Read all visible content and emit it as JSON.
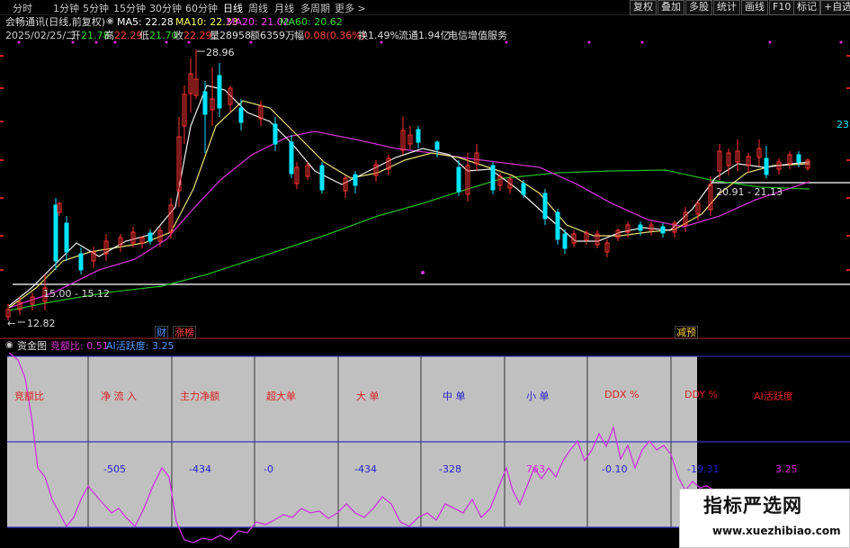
{
  "toolbar": {
    "timeframes": [
      "分时",
      "1分钟",
      "5分钟",
      "15分钟",
      "30分钟",
      "60分钟",
      "日线",
      "周线",
      "月线",
      "多周期",
      "更多 >"
    ],
    "active_timeframe": "日线",
    "right_buttons": [
      "复权",
      "叠加",
      "多股",
      "统计",
      "画线",
      "F10",
      "标记",
      "+自选"
    ]
  },
  "stock": {
    "name": "会畅通讯(日线,前复权)",
    "ma": [
      {
        "label": "MA5: 22.28",
        "color": "#ffffff"
      },
      {
        "label": "MA10: 22.33",
        "color": "#ffff66"
      },
      {
        "label": "MA20: 21.02",
        "color": "#ff44ff"
      },
      {
        "label": "MA60: 20.62",
        "color": "#33dd33"
      }
    ]
  },
  "quote": {
    "date": "2025/02/25/二",
    "open_label": "开",
    "open": "21.78",
    "high_label": "高",
    "high": "22.29",
    "low_label": "低",
    "low": "21.70",
    "close_label": "收",
    "close": "22.29",
    "vol_label": "量",
    "vol": "28958",
    "amt_label": "额",
    "amt": "6359万",
    "chg_label": "幅",
    "chg": "0.08(0.36%)",
    "turnover": "换1.49%",
    "float": "流通1.94亿",
    "sector": "电信增值服务"
  },
  "chart_annotations": {
    "high_price": "28.96",
    "low_price": "12.82",
    "range_left": "15.00 - 15.12",
    "range_right": "20.91 - 21.13",
    "right_axis_value": "23",
    "badges": [
      {
        "text": "财",
        "color": "#5599ff"
      },
      {
        "text": "涨榜",
        "color": "#ff4444"
      },
      {
        "text": "减预",
        "color": "#ffcc33"
      }
    ]
  },
  "indicator": {
    "title": "资金图",
    "param1": "竞额比: 0.51",
    "param2": "AI活跃度: 3.25",
    "headers": [
      {
        "text": "竞额比",
        "color": "#dd2222"
      },
      {
        "text": "净 流 入",
        "color": "#dd2222"
      },
      {
        "text": "主力净额",
        "color": "#dd2222"
      },
      {
        "text": "超大单",
        "color": "#dd2222"
      },
      {
        "text": "大  单",
        "color": "#dd2222"
      },
      {
        "text": "中  单",
        "color": "#2222cc"
      },
      {
        "text": "小  单",
        "color": "#2222cc"
      },
      {
        "text": "DDX %",
        "color": "#dd2222"
      },
      {
        "text": "DDY %",
        "color": "#dd2222"
      },
      {
        "text": "AI活跃度",
        "color": "#dd2222"
      }
    ],
    "values": [
      {
        "text": "",
        "color": "#2222cc"
      },
      {
        "text": "-505",
        "color": "#2222cc"
      },
      {
        "text": "-434",
        "color": "#2222cc"
      },
      {
        "text": "-0",
        "color": "#2222cc"
      },
      {
        "text": "-434",
        "color": "#2222cc"
      },
      {
        "text": "-328",
        "color": "#2222cc"
      },
      {
        "text": "763",
        "color": "#dd22dd"
      },
      {
        "text": "-0.10",
        "color": "#2222cc"
      },
      {
        "text": "-19.31",
        "color": "#2222cc"
      },
      {
        "text": "3.25",
        "color": "#dd22dd"
      }
    ]
  },
  "watermark": {
    "title": "指标严选网",
    "url": "www.xuezhibiao.com"
  }
}
